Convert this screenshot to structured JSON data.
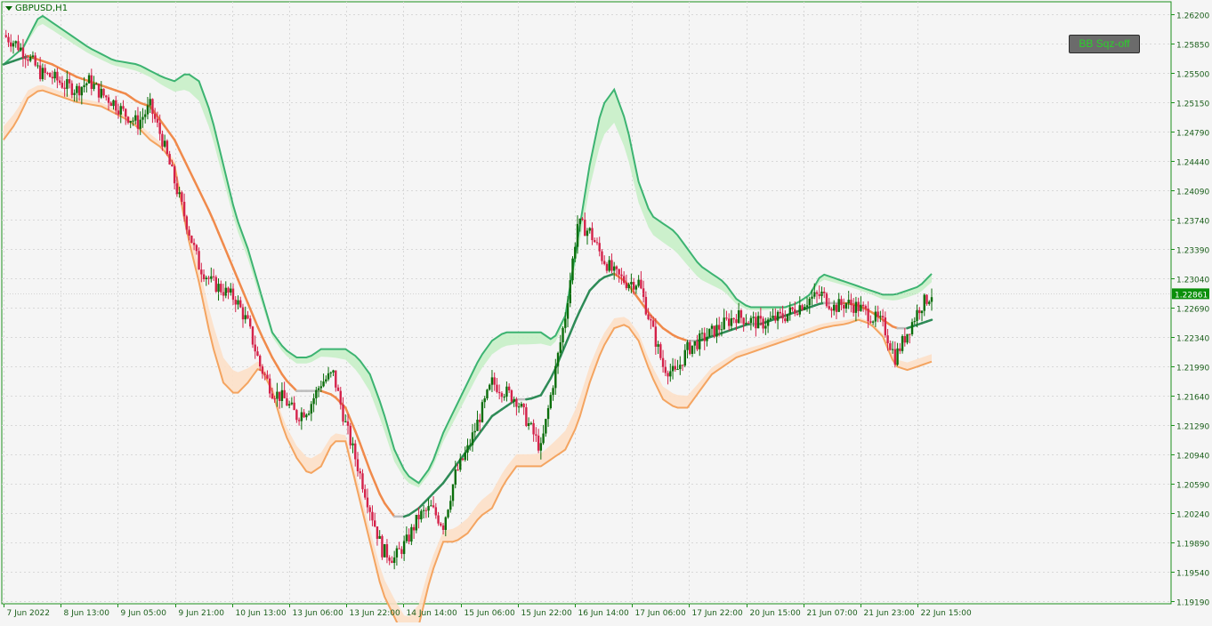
{
  "window": {
    "symbol_title": "GBPUSD,H1",
    "indicator_button_label": "BB Sqz-off"
  },
  "colors": {
    "background": "#f5f5f5",
    "axis": "#1a8f1a",
    "grid": "#d8d8d8",
    "bull_candle": "#0b6e0b",
    "bear_candle": "#d4224a",
    "upper_band": "#3cb371",
    "upper_band_fill": "#c8f0c8",
    "lower_band": "#f4a460",
    "lower_band_fill": "#fde0c8",
    "mid_up": "#2e8b57",
    "mid_down": "#f08a4b",
    "mid_flat": "#bdbdbd",
    "price_tag": "#0b8f0b"
  },
  "chart_data": {
    "type": "candlestick",
    "title": "GBPUSD,H1",
    "ylim": [
      1.1919,
      1.262
    ],
    "y_ticks": [
      "1.26200",
      "1.25850",
      "1.25500",
      "1.25150",
      "1.24790",
      "1.24440",
      "1.24090",
      "1.23740",
      "1.23390",
      "1.23040",
      "1.22690",
      "1.22340",
      "1.21990",
      "1.21640",
      "1.21290",
      "1.20940",
      "1.20590",
      "1.20240",
      "1.19890",
      "1.19540",
      "1.19190"
    ],
    "current_price": "1.22861",
    "x_ticks": [
      "7 Jun 2022",
      "8 Jun 13:00",
      "9 Jun 05:00",
      "9 Jun 21:00",
      "10 Jun 13:00",
      "13 Jun 06:00",
      "13 Jun 22:00",
      "14 Jun 14:00",
      "15 Jun 06:00",
      "15 Jun 22:00",
      "16 Jun 14:00",
      "17 Jun 06:00",
      "17 Jun 22:00",
      "20 Jun 15:00",
      "21 Jun 07:00",
      "21 Jun 23:00",
      "22 Jun 15:00"
    ],
    "close_path": [
      [
        0,
        1.2595
      ],
      [
        5,
        1.2585
      ],
      [
        10,
        1.257
      ],
      [
        15,
        1.255
      ],
      [
        20,
        1.2545
      ],
      [
        25,
        1.2535
      ],
      [
        30,
        1.253
      ],
      [
        35,
        1.254
      ],
      [
        40,
        1.2525
      ],
      [
        45,
        1.2515
      ],
      [
        50,
        1.25
      ],
      [
        55,
        1.249
      ],
      [
        60,
        1.251
      ],
      [
        65,
        1.247
      ],
      [
        70,
        1.242
      ],
      [
        75,
        1.237
      ],
      [
        80,
        1.232
      ],
      [
        85,
        1.23
      ],
      [
        90,
        1.229
      ],
      [
        95,
        1.228
      ],
      [
        100,
        1.225
      ],
      [
        105,
        1.22
      ],
      [
        110,
        1.217
      ],
      [
        115,
        1.216
      ],
      [
        120,
        1.214
      ],
      [
        125,
        1.215
      ],
      [
        130,
        1.218
      ],
      [
        135,
        1.219
      ],
      [
        140,
        1.213
      ],
      [
        145,
        1.208
      ],
      [
        150,
        1.203
      ],
      [
        155,
        1.198
      ],
      [
        160,
        1.197
      ],
      [
        165,
        1.199
      ],
      [
        170,
        1.202
      ],
      [
        175,
        1.203
      ],
      [
        180,
        1.201
      ],
      [
        185,
        1.207
      ],
      [
        190,
        1.21
      ],
      [
        195,
        1.214
      ],
      [
        200,
        1.218
      ],
      [
        205,
        1.217
      ],
      [
        210,
        1.216
      ],
      [
        215,
        1.213
      ],
      [
        220,
        1.21
      ],
      [
        225,
        1.218
      ],
      [
        230,
        1.226
      ],
      [
        235,
        1.237
      ],
      [
        240,
        1.236
      ],
      [
        245,
        1.233
      ],
      [
        250,
        1.231
      ],
      [
        255,
        1.23
      ],
      [
        260,
        1.23
      ],
      [
        265,
        1.225
      ],
      [
        270,
        1.22
      ],
      [
        275,
        1.219
      ],
      [
        280,
        1.222
      ],
      [
        285,
        1.223
      ],
      [
        290,
        1.224
      ],
      [
        295,
        1.225
      ],
      [
        300,
        1.226
      ],
      [
        305,
        1.2255
      ],
      [
        310,
        1.225
      ],
      [
        315,
        1.2255
      ],
      [
        320,
        1.226
      ],
      [
        325,
        1.227
      ],
      [
        330,
        1.228
      ],
      [
        335,
        1.2285
      ],
      [
        340,
        1.227
      ],
      [
        345,
        1.2275
      ],
      [
        350,
        1.227
      ],
      [
        355,
        1.226
      ],
      [
        360,
        1.225
      ],
      [
        365,
        1.221
      ],
      [
        370,
        1.224
      ],
      [
        375,
        1.227
      ],
      [
        380,
        1.2286
      ]
    ],
    "upper_band": [
      [
        0,
        1.256
      ],
      [
        8,
        1.258
      ],
      [
        15,
        1.262
      ],
      [
        25,
        1.26
      ],
      [
        35,
        1.258
      ],
      [
        45,
        1.2565
      ],
      [
        55,
        1.256
      ],
      [
        65,
        1.2545
      ],
      [
        70,
        1.254
      ],
      [
        75,
        1.255
      ],
      [
        80,
        1.254
      ],
      [
        85,
        1.25
      ],
      [
        90,
        1.244
      ],
      [
        95,
        1.238
      ],
      [
        100,
        1.234
      ],
      [
        105,
        1.229
      ],
      [
        110,
        1.224
      ],
      [
        115,
        1.222
      ],
      [
        120,
        1.221
      ],
      [
        125,
        1.221
      ],
      [
        130,
        1.222
      ],
      [
        135,
        1.222
      ],
      [
        140,
        1.222
      ],
      [
        145,
        1.221
      ],
      [
        150,
        1.219
      ],
      [
        155,
        1.215
      ],
      [
        160,
        1.21
      ],
      [
        165,
        1.207
      ],
      [
        170,
        1.206
      ],
      [
        175,
        1.208
      ],
      [
        180,
        1.212
      ],
      [
        185,
        1.215
      ],
      [
        190,
        1.218
      ],
      [
        195,
        1.221
      ],
      [
        200,
        1.223
      ],
      [
        205,
        1.224
      ],
      [
        210,
        1.224
      ],
      [
        215,
        1.224
      ],
      [
        220,
        1.224
      ],
      [
        225,
        1.223
      ],
      [
        230,
        1.226
      ],
      [
        235,
        1.235
      ],
      [
        240,
        1.244
      ],
      [
        245,
        1.251
      ],
      [
        250,
        1.253
      ],
      [
        255,
        1.249
      ],
      [
        260,
        1.242
      ],
      [
        265,
        1.238
      ],
      [
        270,
        1.237
      ],
      [
        275,
        1.236
      ],
      [
        280,
        1.234
      ],
      [
        285,
        1.232
      ],
      [
        290,
        1.231
      ],
      [
        295,
        1.23
      ],
      [
        300,
        1.228
      ],
      [
        305,
        1.227
      ],
      [
        310,
        1.227
      ],
      [
        315,
        1.227
      ],
      [
        320,
        1.227
      ],
      [
        325,
        1.2275
      ],
      [
        330,
        1.2285
      ],
      [
        335,
        1.231
      ],
      [
        340,
        1.2305
      ],
      [
        345,
        1.23
      ],
      [
        350,
        1.2295
      ],
      [
        355,
        1.229
      ],
      [
        360,
        1.2285
      ],
      [
        365,
        1.2285
      ],
      [
        370,
        1.229
      ],
      [
        375,
        1.2295
      ],
      [
        380,
        1.231
      ]
    ],
    "middle_band": [
      [
        0,
        1.256
      ],
      [
        10,
        1.257
      ],
      [
        20,
        1.256
      ],
      [
        30,
        1.2545
      ],
      [
        40,
        1.2535
      ],
      [
        50,
        1.2525
      ],
      [
        55,
        1.2515
      ],
      [
        60,
        1.251
      ],
      [
        65,
        1.249
      ],
      [
        70,
        1.247
      ],
      [
        75,
        1.244
      ],
      [
        80,
        1.241
      ],
      [
        85,
        1.238
      ],
      [
        90,
        1.2345
      ],
      [
        95,
        1.231
      ],
      [
        100,
        1.2275
      ],
      [
        105,
        1.224
      ],
      [
        110,
        1.221
      ],
      [
        115,
        1.2185
      ],
      [
        120,
        1.217
      ],
      [
        125,
        1.217
      ],
      [
        130,
        1.217
      ],
      [
        135,
        1.2165
      ],
      [
        140,
        1.215
      ],
      [
        145,
        1.2115
      ],
      [
        150,
        1.2075
      ],
      [
        155,
        1.204
      ],
      [
        160,
        1.202
      ],
      [
        165,
        1.202
      ],
      [
        170,
        1.203
      ],
      [
        175,
        1.2045
      ],
      [
        180,
        1.206
      ],
      [
        185,
        1.208
      ],
      [
        190,
        1.21
      ],
      [
        195,
        1.212
      ],
      [
        200,
        1.214
      ],
      [
        205,
        1.215
      ],
      [
        210,
        1.216
      ],
      [
        215,
        1.216
      ],
      [
        220,
        1.2165
      ],
      [
        225,
        1.219
      ],
      [
        230,
        1.2225
      ],
      [
        235,
        1.226
      ],
      [
        240,
        1.229
      ],
      [
        245,
        1.2305
      ],
      [
        250,
        1.231
      ],
      [
        255,
        1.23
      ],
      [
        260,
        1.228
      ],
      [
        265,
        1.226
      ],
      [
        270,
        1.2245
      ],
      [
        275,
        1.2235
      ],
      [
        280,
        1.223
      ],
      [
        285,
        1.223
      ],
      [
        290,
        1.2235
      ],
      [
        295,
        1.224
      ],
      [
        300,
        1.2245
      ],
      [
        305,
        1.225
      ],
      [
        310,
        1.225
      ],
      [
        315,
        1.2255
      ],
      [
        320,
        1.226
      ],
      [
        325,
        1.2265
      ],
      [
        330,
        1.227
      ],
      [
        335,
        1.2275
      ],
      [
        340,
        1.2275
      ],
      [
        345,
        1.2275
      ],
      [
        350,
        1.2272
      ],
      [
        355,
        1.2265
      ],
      [
        360,
        1.2255
      ],
      [
        365,
        1.2245
      ],
      [
        370,
        1.2245
      ],
      [
        375,
        1.225
      ],
      [
        380,
        1.2255
      ]
    ],
    "lower_band": [
      [
        0,
        1.247
      ],
      [
        5,
        1.249
      ],
      [
        10,
        1.252
      ],
      [
        15,
        1.253
      ],
      [
        20,
        1.2525
      ],
      [
        30,
        1.2515
      ],
      [
        40,
        1.251
      ],
      [
        50,
        1.2495
      ],
      [
        55,
        1.2485
      ],
      [
        60,
        1.247
      ],
      [
        65,
        1.246
      ],
      [
        70,
        1.244
      ],
      [
        75,
        1.236
      ],
      [
        80,
        1.23
      ],
      [
        85,
        1.223
      ],
      [
        90,
        1.218
      ],
      [
        95,
        1.2165
      ],
      [
        100,
        1.218
      ],
      [
        105,
        1.22
      ],
      [
        110,
        1.217
      ],
      [
        115,
        1.212
      ],
      [
        120,
        1.209
      ],
      [
        125,
        1.207
      ],
      [
        130,
        1.208
      ],
      [
        135,
        1.211
      ],
      [
        140,
        1.211
      ],
      [
        145,
        1.205
      ],
      [
        150,
        1.199
      ],
      [
        155,
        1.193
      ],
      [
        160,
        1.19
      ],
      [
        165,
        1.187
      ],
      [
        170,
        1.189
      ],
      [
        175,
        1.195
      ],
      [
        180,
        1.199
      ],
      [
        185,
        1.199
      ],
      [
        190,
        1.2
      ],
      [
        195,
        1.202
      ],
      [
        200,
        1.203
      ],
      [
        205,
        1.206
      ],
      [
        210,
        1.208
      ],
      [
        215,
        1.208
      ],
      [
        220,
        1.208
      ],
      [
        225,
        1.209
      ],
      [
        230,
        1.21
      ],
      [
        235,
        1.213
      ],
      [
        240,
        1.218
      ],
      [
        245,
        1.222
      ],
      [
        250,
        1.2245
      ],
      [
        255,
        1.225
      ],
      [
        260,
        1.223
      ],
      [
        265,
        1.219
      ],
      [
        270,
        1.216
      ],
      [
        275,
        1.215
      ],
      [
        280,
        1.215
      ],
      [
        285,
        1.217
      ],
      [
        290,
        1.219
      ],
      [
        295,
        1.22
      ],
      [
        300,
        1.221
      ],
      [
        305,
        1.2215
      ],
      [
        310,
        1.222
      ],
      [
        315,
        1.2225
      ],
      [
        320,
        1.223
      ],
      [
        325,
        1.2235
      ],
      [
        330,
        1.224
      ],
      [
        335,
        1.2245
      ],
      [
        340,
        1.2248
      ],
      [
        345,
        1.225
      ],
      [
        350,
        1.2255
      ],
      [
        355,
        1.225
      ],
      [
        360,
        1.2235
      ],
      [
        365,
        1.22
      ],
      [
        370,
        1.2195
      ],
      [
        375,
        1.22
      ],
      [
        380,
        1.2205
      ]
    ]
  }
}
